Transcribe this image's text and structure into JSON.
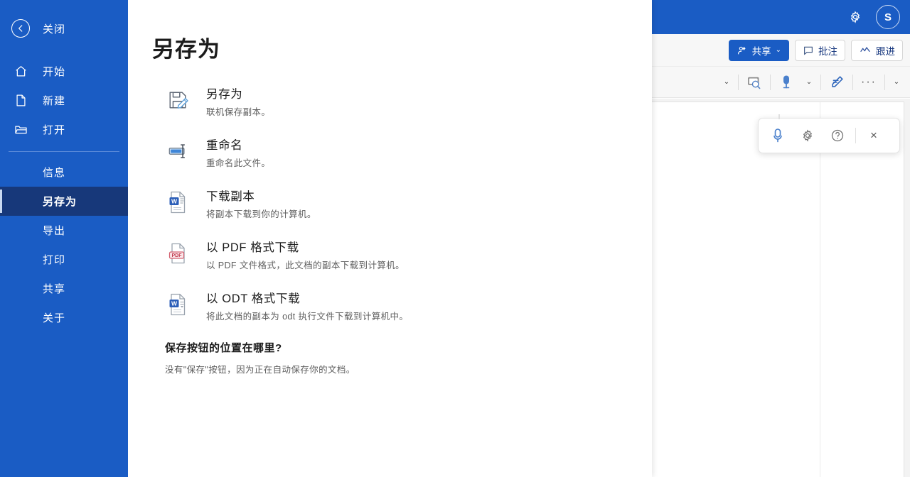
{
  "app": {
    "header": {
      "settings_icon": "gear-icon",
      "avatar_initial": "S",
      "brand_blue": "#1a5cc4"
    },
    "ribbon": {
      "share_label": "共享",
      "share_icon": "share-person-icon",
      "share_chevron": "⌄",
      "comments_label": "批注",
      "comments_icon": "comment-bubble-icon",
      "followup_label": "跟进",
      "followup_icon": "activity-line-icon"
    },
    "toolbar": {
      "expand_caret": "⌄",
      "find_icon": "find-icon",
      "dictate_icon": "microphone-icon",
      "dictate_chevron": "⌄",
      "editor_icon": "editor-pen-icon",
      "overflow_label": "···",
      "collapse_caret": "⌄"
    },
    "float_toolbar": {
      "mic_icon": "microphone-icon",
      "settings_icon": "gear-icon",
      "help_icon": "help-circle-icon",
      "close_icon": "close-x-icon",
      "close_label": "×"
    }
  },
  "backstage": {
    "close": {
      "label": "关闭",
      "icon": "back-arrow-circle-icon"
    },
    "nav_items": [
      {
        "label": "开始",
        "icon": "home-icon"
      },
      {
        "label": "新建",
        "icon": "new-document-icon"
      },
      {
        "label": "打开",
        "icon": "open-folder-icon"
      }
    ],
    "sub_items": [
      {
        "label": "信息",
        "active": false
      },
      {
        "label": "另存为",
        "active": true
      },
      {
        "label": "导出",
        "active": false
      },
      {
        "label": "打印",
        "active": false
      },
      {
        "label": "共享",
        "active": false
      },
      {
        "label": "关于",
        "active": false
      }
    ],
    "title": "另存为",
    "options": [
      {
        "title": "另存为",
        "desc": "联机保存副本。",
        "icon": "save-as-floppy-pencil-icon"
      },
      {
        "title": "重命名",
        "desc": "重命名此文件。",
        "icon": "rename-textfield-icon"
      },
      {
        "title": "下载副本",
        "desc": "将副本下载到你的计算机。",
        "icon": "word-document-icon"
      },
      {
        "title": "以 PDF 格式下载",
        "desc": "以 PDF 文件格式，此文档的副本下载到计算机。",
        "icon": "pdf-document-icon"
      },
      {
        "title": "以 ODT 格式下载",
        "desc": "将此文档的副本为 odt 执行文件下载到计算机中。",
        "icon": "odt-document-icon"
      }
    ],
    "footer": {
      "heading": "保存按钮的位置在哪里?",
      "paragraph": "没有\"保存\"按钮，因为正在自动保存你的文档。"
    }
  }
}
